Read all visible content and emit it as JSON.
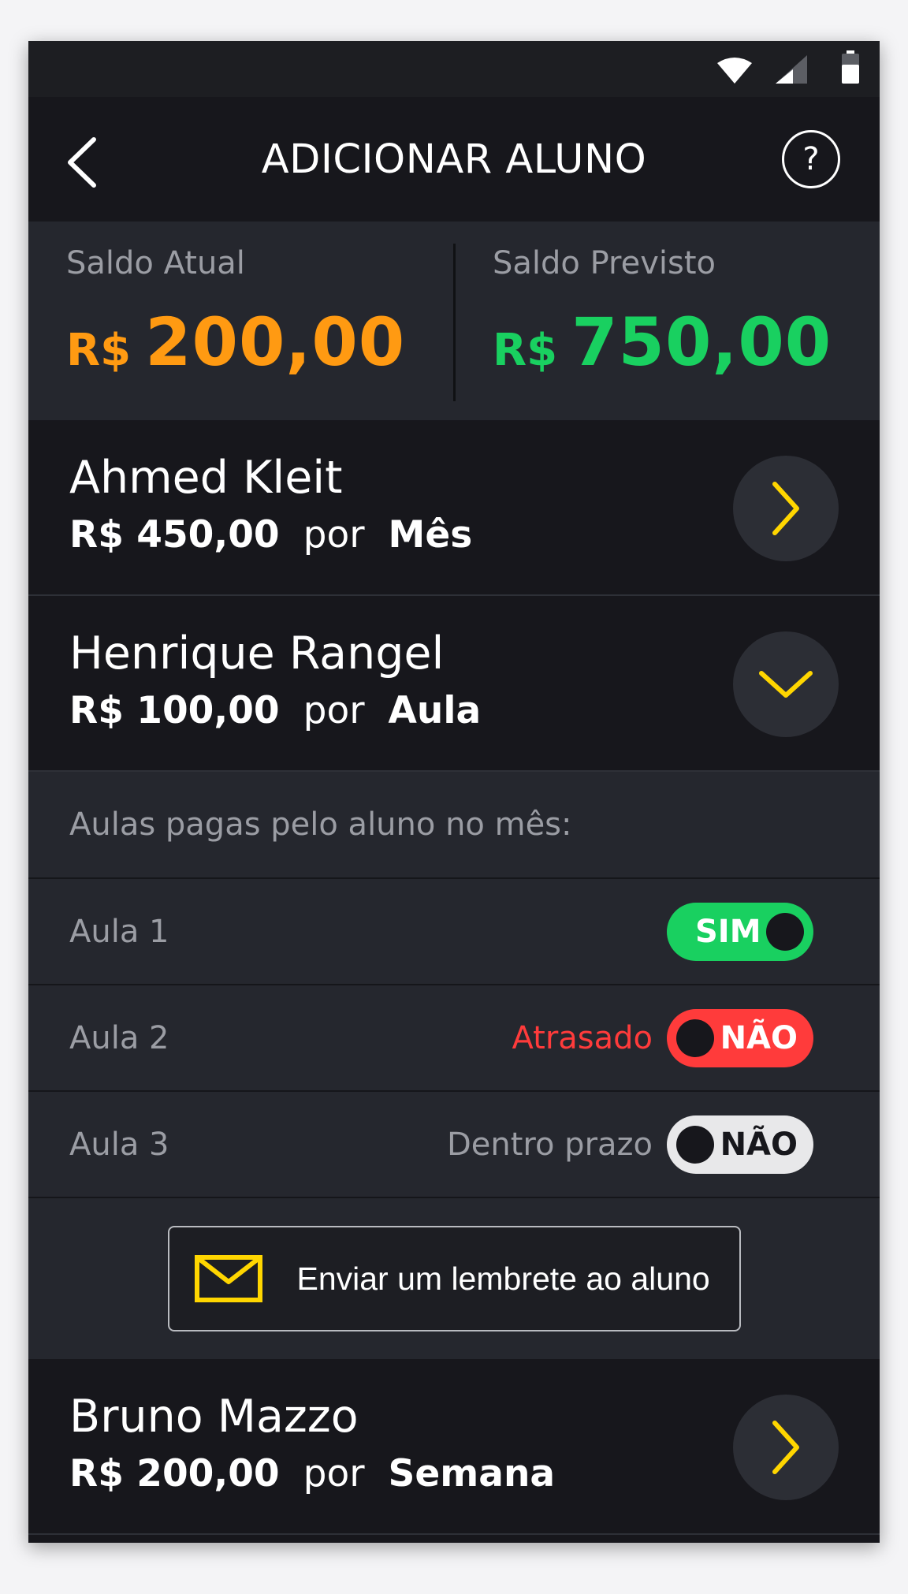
{
  "header": {
    "title": "ADICIONAR ALUNO",
    "help_label": "?"
  },
  "balance": {
    "current": {
      "label": "Saldo Atual",
      "currency": "R$",
      "amount": "200,00",
      "color": "#ff9a12"
    },
    "projected": {
      "label": "Saldo Previsto",
      "currency": "R$",
      "amount": "750,00",
      "color": "#19d060"
    }
  },
  "students": [
    {
      "name": "Ahmed Kleit",
      "amount": "R$ 450,00",
      "por": "por",
      "period": "Mês",
      "state": "collapsed"
    },
    {
      "name": "Henrique Rangel",
      "amount": "R$ 100,00",
      "por": "por",
      "period": "Aula",
      "state": "expanded"
    },
    {
      "name": "Bruno Mazzo",
      "amount": "R$ 200,00",
      "por": "por",
      "period": "Semana",
      "state": "collapsed"
    }
  ],
  "panel": {
    "heading": "Aulas pagas pelo aluno no mês:",
    "lessons": [
      {
        "label": "Aula 1",
        "status": "",
        "toggle": "SIM",
        "toggle_color": "#19d060"
      },
      {
        "label": "Aula 2",
        "status": "Atrasado",
        "toggle": "NÃO",
        "toggle_color": "#ff3b3b"
      },
      {
        "label": "Aula 3",
        "status": "Dentro prazo",
        "toggle": "NÃO",
        "toggle_color": "#e8e8ea"
      }
    ],
    "reminder_label": "Enviar um lembrete ao aluno"
  },
  "colors": {
    "accent": "#ffd600",
    "background": "#17171c",
    "panel": "#25272e"
  },
  "icons": [
    "wifi-icon",
    "signal-icon",
    "battery-icon",
    "back-arrow-icon",
    "help-icon",
    "chevron-right-icon",
    "chevron-down-icon",
    "envelope-icon"
  ]
}
